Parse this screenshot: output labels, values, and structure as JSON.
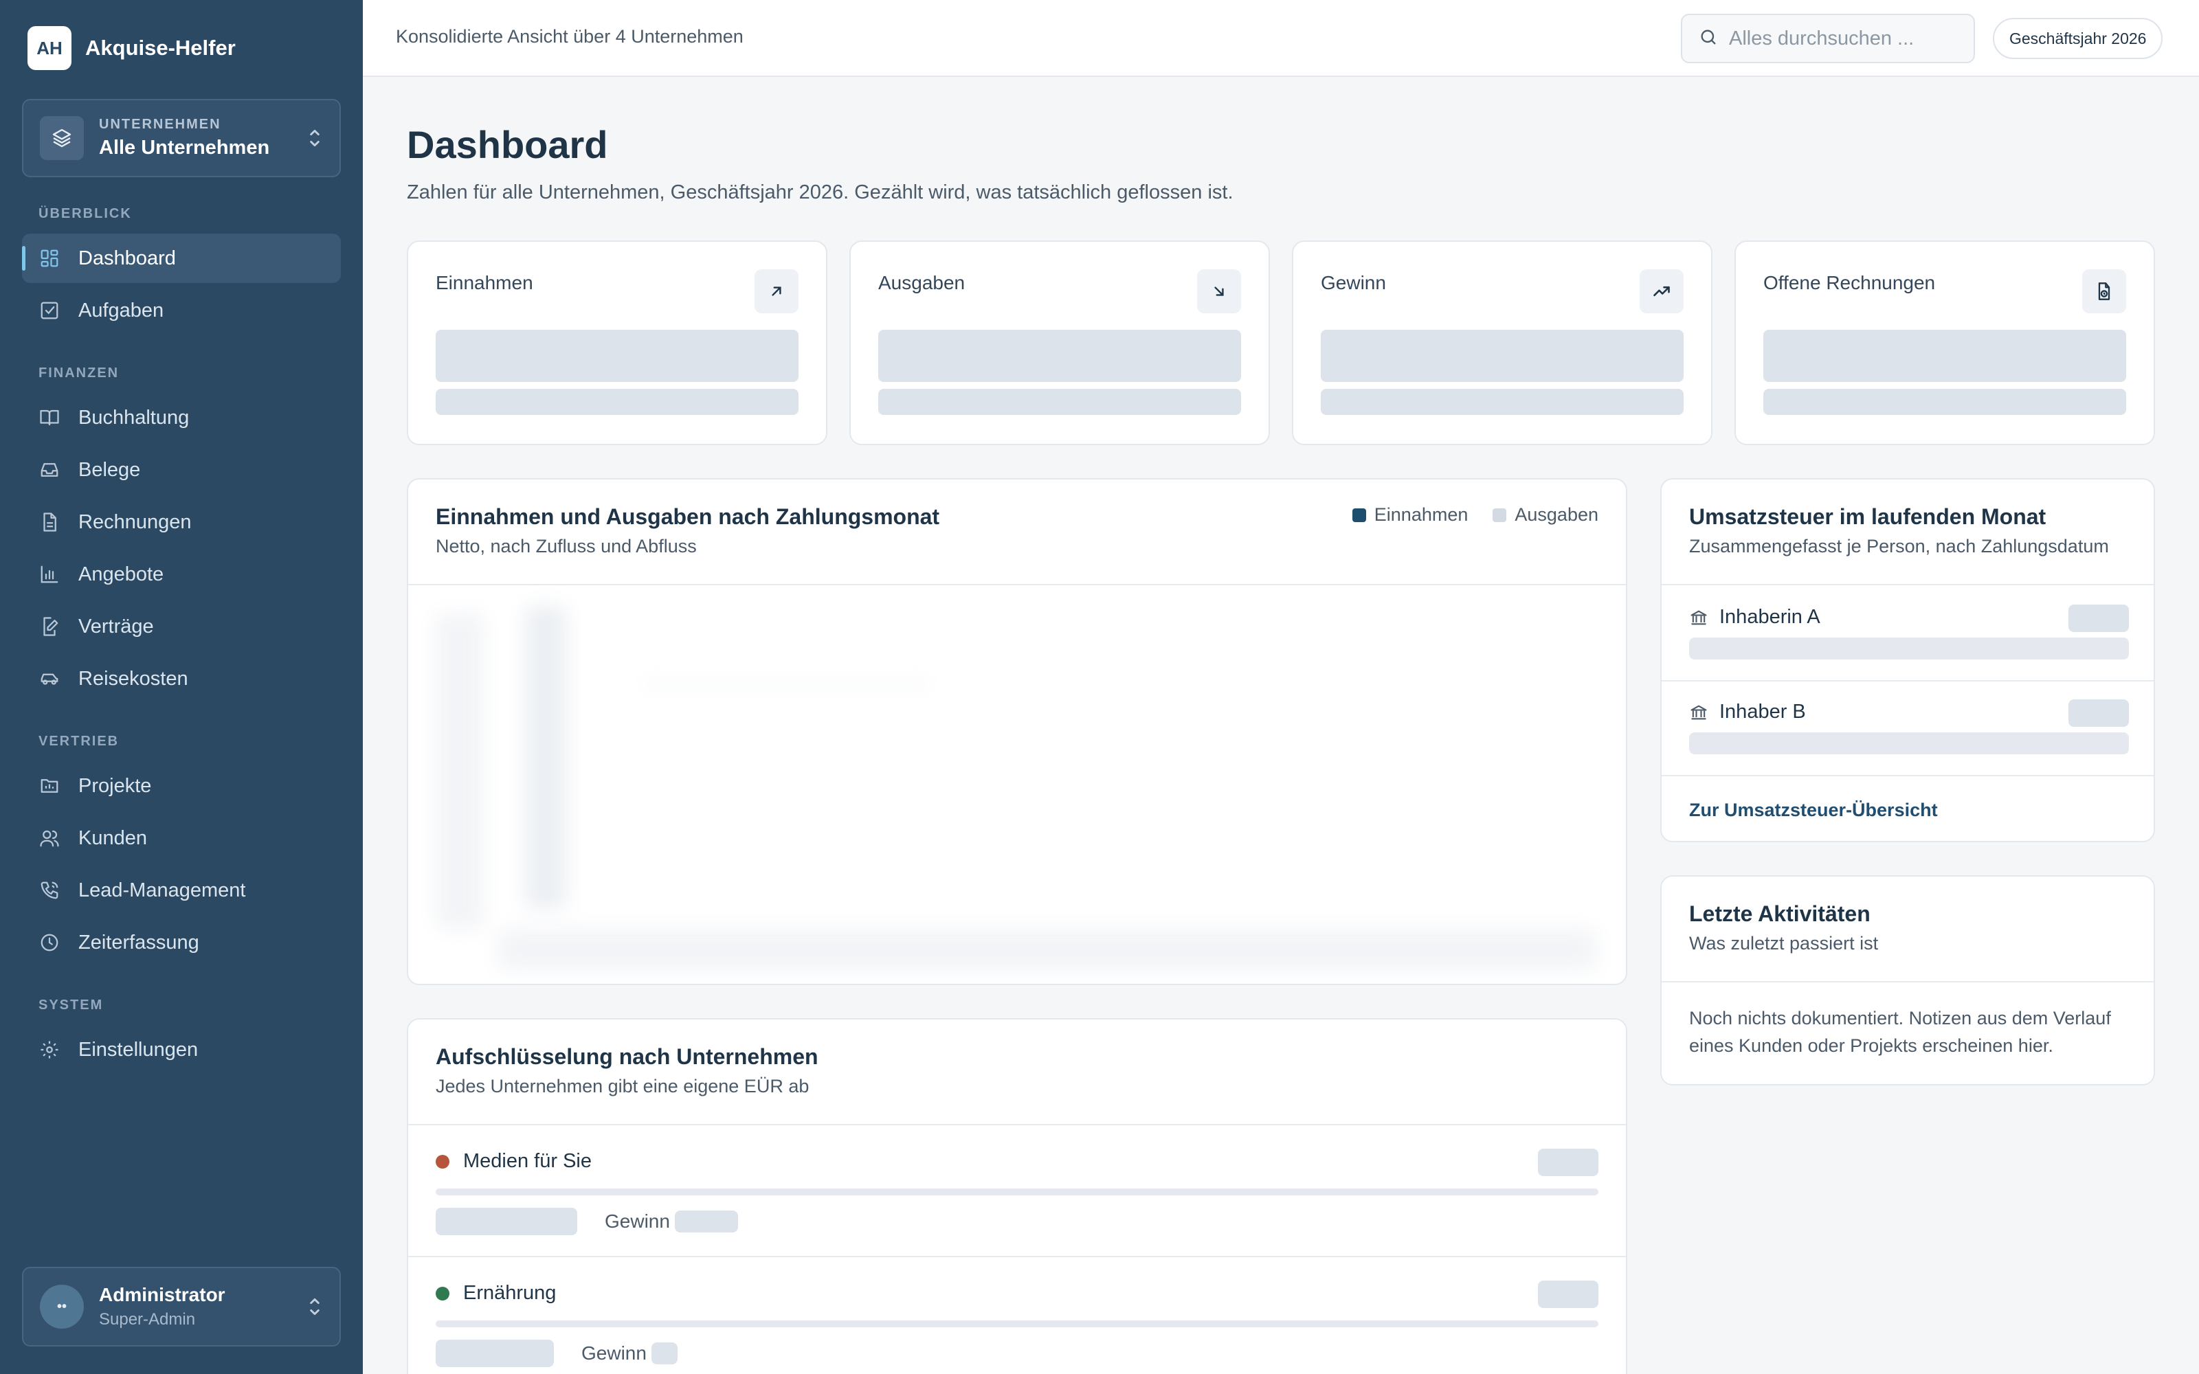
{
  "brand": {
    "logo_text": "AH",
    "name": "Akquise-Helfer"
  },
  "company_switcher": {
    "label": "UNTERNEHMEN",
    "value": "Alle Unternehmen"
  },
  "nav": {
    "sections": [
      {
        "title": "ÜBERBLICK"
      },
      {
        "title": "FINANZEN"
      },
      {
        "title": "VERTRIEB"
      },
      {
        "title": "SYSTEM"
      }
    ],
    "items": [
      {
        "label": "Dashboard",
        "icon": "dashboard-icon",
        "active": true
      },
      {
        "label": "Aufgaben",
        "icon": "task-check-icon"
      },
      {
        "label": "Buchhaltung",
        "icon": "book-icon"
      },
      {
        "label": "Belege",
        "icon": "inbox-icon"
      },
      {
        "label": "Rechnungen",
        "icon": "document-icon"
      },
      {
        "label": "Angebote",
        "icon": "bar-chart-icon"
      },
      {
        "label": "Verträge",
        "icon": "contract-edit-icon"
      },
      {
        "label": "Reisekosten",
        "icon": "car-icon"
      },
      {
        "label": "Projekte",
        "icon": "folder-icon"
      },
      {
        "label": "Kunden",
        "icon": "users-icon"
      },
      {
        "label": "Lead-Management",
        "icon": "phone-icon"
      },
      {
        "label": "Zeiterfassung",
        "icon": "clock-icon"
      },
      {
        "label": "Einstellungen",
        "icon": "gear-icon"
      }
    ]
  },
  "user": {
    "avatar_text": "••",
    "name": "Administrator",
    "role": "Super-Admin"
  },
  "topbar": {
    "title": "Konsolidierte Ansicht über 4 Unternehmen",
    "search_placeholder": "Alles durchsuchen ...",
    "fiscal_year": "Geschäftsjahr 2026"
  },
  "page": {
    "title": "Dashboard",
    "subtitle": "Zahlen für alle Unternehmen, Geschäftsjahr 2026. Gezählt wird, was tatsächlich geflossen ist."
  },
  "kpis": [
    {
      "label": "Einnahmen",
      "icon": "arrow-up-right-icon"
    },
    {
      "label": "Ausgaben",
      "icon": "arrow-down-right-icon"
    },
    {
      "label": "Gewinn",
      "icon": "trending-up-icon"
    },
    {
      "label": "Offene Rechnungen",
      "icon": "invoice-clock-icon"
    }
  ],
  "chart_card": {
    "title": "Einnahmen und Ausgaben nach Zahlungsmonat",
    "subtitle": "Netto, nach Zufluss und Abfluss",
    "legend": [
      {
        "label": "Einnahmen",
        "color": "#1d4e6e"
      },
      {
        "label": "Ausgaben",
        "color": "#d3dae2"
      }
    ]
  },
  "chart_data": {
    "type": "bar",
    "title": "Einnahmen und Ausgaben nach Zahlungsmonat",
    "subtitle": "Netto, nach Zufluss und Abfluss",
    "categories": [],
    "series": [
      {
        "name": "Einnahmen",
        "values": []
      },
      {
        "name": "Ausgaben",
        "values": []
      }
    ],
    "loading": true
  },
  "vat_card": {
    "title": "Umsatzsteuer im laufenden Monat",
    "subtitle": "Zusammengefasst je Person, nach Zahlungsdatum",
    "persons": [
      {
        "name": "Inhaberin A",
        "icon": "bank-icon"
      },
      {
        "name": "Inhaber B",
        "icon": "bank-icon"
      }
    ],
    "link": "Zur Umsatzsteuer-Übersicht"
  },
  "activity_card": {
    "title": "Letzte Aktivitäten",
    "subtitle": "Was zuletzt passiert ist",
    "empty_text": "Noch nichts dokumentiert. Notizen aus dem Verlauf eines Kunden oder Projekts erscheinen hier."
  },
  "breakdown_card": {
    "title": "Aufschlüsselung nach Unternehmen",
    "subtitle": "Jedes Unternehmen gibt eine eigene EÜR ab",
    "companies": [
      {
        "name": "Medien für Sie",
        "color": "#b5563a",
        "profit_label": "Gewinn"
      },
      {
        "name": "Ernährung",
        "color": "#2f7a4f",
        "profit_label": "Gewinn"
      }
    ]
  }
}
